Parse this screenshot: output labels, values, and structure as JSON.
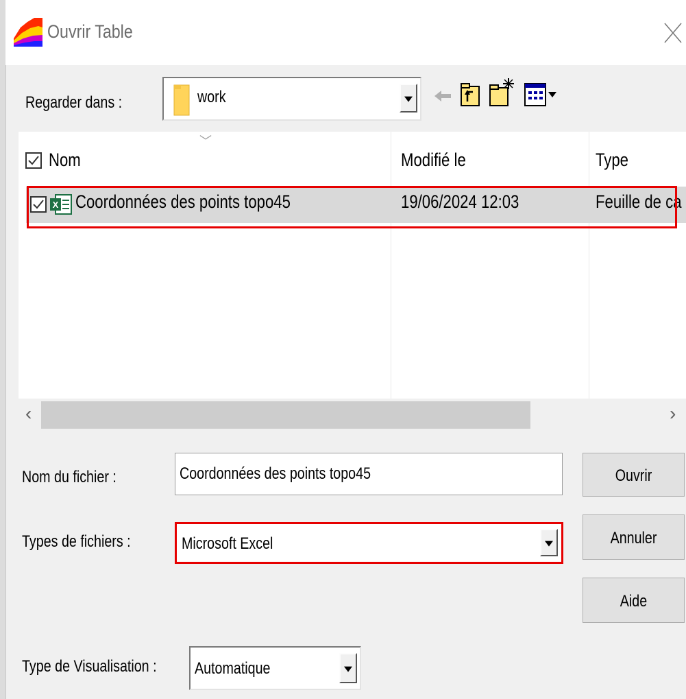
{
  "window": {
    "title": "Ouvrir Table",
    "close_glyph": "╳"
  },
  "toolbar": {
    "look_in_label": "Regarder dans :",
    "look_in_value": "work",
    "icons": [
      "folder-icon",
      "back-arrow-icon",
      "up-folder-icon",
      "new-folder-icon",
      "view-menu-icon"
    ]
  },
  "file_list": {
    "columns": [
      {
        "label": "Nom"
      },
      {
        "label": "Modifié le"
      },
      {
        "label": "Type"
      }
    ],
    "sort_indicator": "﹀",
    "rows": [
      {
        "name": "Coordonnées des points topo45",
        "modified": "19/06/2024 12:03",
        "type": "Feuille de ca",
        "icon": "excel-file-icon",
        "selected": true
      }
    ]
  },
  "scrollbar": {
    "left_arrow": "‹",
    "right_arrow": "›"
  },
  "form": {
    "filename_label": "Nom du fichier :",
    "filename_value": "Coordonnées des points topo45",
    "filetype_label": "Types de fichiers :",
    "filetype_value": "Microsoft  Excel",
    "viewtype_label": "Type de Visualisation :",
    "viewtype_value": "Automatique"
  },
  "buttons": {
    "open": "Ouvrir",
    "cancel": "Annuler",
    "help": "Aide"
  },
  "colors": {
    "highlight_box": "#e60000",
    "selection": "#d9d9d9",
    "folder": "#ffd45a"
  }
}
